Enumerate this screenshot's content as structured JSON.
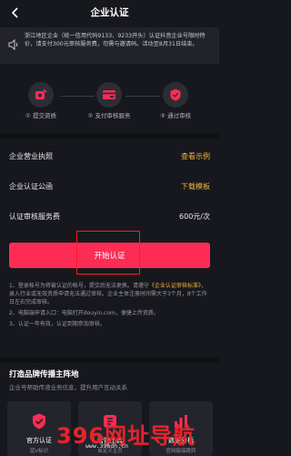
{
  "header": {
    "title": "企业认证"
  },
  "notice": {
    "text": "浙江地区企业（统一信用代码9133、9233开头）认证抖音企业号限时特价，请支付300元审核服务费，勿需与邀请码。活动至8月31日结束。"
  },
  "steps": [
    {
      "label": "① 提交资质",
      "icon": "submit-docs-icon"
    },
    {
      "label": "② 支付审核服务",
      "icon": "payment-icon"
    },
    {
      "label": "③ 通过审核",
      "icon": "approved-icon"
    }
  ],
  "rows": {
    "license": {
      "label": "企业营业执照",
      "action": "查看示例"
    },
    "letter": {
      "label": "企业认证公函",
      "action": "下载模板"
    },
    "fee": {
      "label": "认证审核服务费",
      "value": "600元/次"
    }
  },
  "start_button": {
    "label": "开始认证"
  },
  "notes": {
    "n1_a": "1、登录帐号为将被认证的帐号，提交后无法更换。请遵守",
    "n1_link": "《企业认证审核标准》",
    "n1_b": "，录入行业或无效资质申请无法通过审核。企业主体注册时间需大于3个月，8个工作日左右完成审核。",
    "n2": "2、电脑端申请入口：电脑打开douyin.com，便捷上传资质。",
    "n3": "3、认证一年有效，认证到期参加审核。"
  },
  "section": {
    "title": "打造品牌传播主阵地",
    "subtitle": "企业号帮助传递业务信息，提升用户互动关系"
  },
  "cards": [
    {
      "title": "官方认证",
      "sub": "蓝V标识",
      "icon": "verified-shield-icon",
      "color": "#fe2c55"
    },
    {
      "title": "营销工具",
      "sub": "自定义主页",
      "icon": "marketing-tag-icon",
      "color": "#fe2c55"
    },
    {
      "title": "数据分析",
      "sub": "官网链接跳转",
      "icon": "analytics-icon",
      "color": "#fe2c55"
    }
  ],
  "watermark": {
    "main": "396网址导航",
    "url": "www.396dh.cn"
  }
}
